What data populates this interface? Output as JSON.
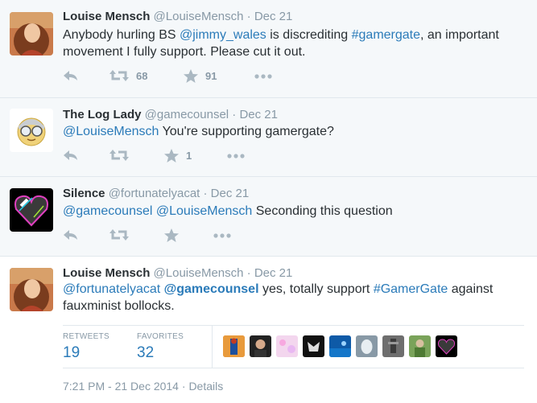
{
  "tweets": [
    {
      "fullname": "Louise Mensch",
      "screen_name": "@LouiseMensch",
      "sep": "·",
      "time": "Dec 21",
      "text_parts": [
        "Anybody hurling BS ",
        "@jimmy_wales",
        " is discrediting ",
        "#gamergate",
        ", an important movement I fully support. Please cut it out."
      ],
      "retweets": "68",
      "favorites": "91"
    },
    {
      "fullname": "The Log Lady",
      "screen_name": "@gamecounsel",
      "sep": "·",
      "time": "Dec 21",
      "text_parts": [
        "@LouiseMensch",
        " You're supporting gamergate?"
      ],
      "retweets": "",
      "favorites": "1"
    },
    {
      "fullname": "Silence",
      "screen_name": "@fortunatelyacat",
      "sep": "·",
      "time": "Dec 21",
      "text_parts": [
        "@gamecounsel",
        " ",
        "@LouiseMensch",
        " Seconding this question"
      ],
      "retweets": "",
      "favorites": ""
    },
    {
      "fullname": "Louise Mensch",
      "screen_name": "@LouiseMensch",
      "sep": "·",
      "time": "Dec 21",
      "text_parts": [
        "@fortunatelyacat",
        " ",
        "@gamecounsel",
        " yes, totally support ",
        "#GamerGate",
        " against fauxminist bollocks."
      ]
    }
  ],
  "stats": {
    "retweets_label": "RETWEETS",
    "retweets_value": "19",
    "favorites_label": "FAVORITES",
    "favorites_value": "32"
  },
  "meta": {
    "timestamp": "7:21 PM - 21 Dec 2014",
    "sep": "·",
    "details": "Details"
  },
  "colors": {
    "link": "#2b7bb9",
    "muted": "#8899a6",
    "text": "#292f33",
    "context_bg": "#f5f8fa"
  },
  "icons": [
    "reply-icon",
    "retweet-icon",
    "favorite-star-icon",
    "more-icon"
  ]
}
